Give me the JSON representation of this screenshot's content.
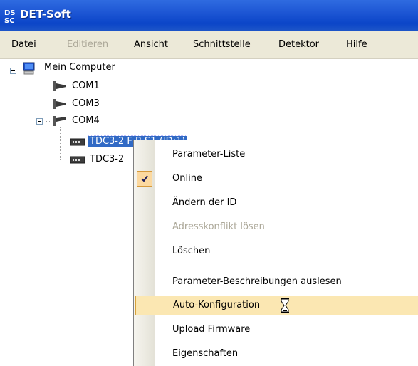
{
  "window": {
    "title": "DET-Soft",
    "logo_text": "DS"
  },
  "menubar": {
    "items": [
      {
        "label": "Datei",
        "disabled": false
      },
      {
        "label": "Editieren",
        "disabled": true
      },
      {
        "label": "Ansicht",
        "disabled": false
      },
      {
        "label": "Schnittstelle",
        "disabled": false
      },
      {
        "label": "Detektor",
        "disabled": false
      },
      {
        "label": "Hilfe",
        "disabled": false
      }
    ]
  },
  "tree": {
    "root": {
      "label": "Mein Computer",
      "icon": "computer-icon",
      "expanded": true
    },
    "ports": [
      {
        "label": "COM1",
        "icon": "serial-port-icon"
      },
      {
        "label": "COM3",
        "icon": "serial-port-icon"
      },
      {
        "label": "COM4",
        "icon": "serial-port-icon",
        "expanded": true
      }
    ],
    "devices": [
      {
        "label": "TDC3-2 F B S1 (ID:1)",
        "icon": "device-icon",
        "selected": true
      },
      {
        "label": "TDC3-2",
        "icon": "device-icon",
        "selected": false
      }
    ]
  },
  "context_menu": {
    "items": [
      {
        "label": "Parameter-Liste",
        "disabled": false,
        "checked": false
      },
      {
        "label": "Online",
        "disabled": false,
        "checked": true
      },
      {
        "label": "Ändern der ID",
        "disabled": false,
        "checked": false
      },
      {
        "label": "Adresskonflikt lösen",
        "disabled": true,
        "checked": false
      },
      {
        "label": "Löschen",
        "disabled": false,
        "checked": false
      },
      {
        "label": "Parameter-Beschreibungen auslesen",
        "disabled": false,
        "checked": false
      },
      {
        "label": "Auto-Konfiguration",
        "disabled": false,
        "checked": false,
        "hovered": true
      },
      {
        "label": "Upload Firmware",
        "disabled": false,
        "checked": false
      },
      {
        "label": "Eigenschaften",
        "disabled": false,
        "checked": false
      }
    ],
    "icons": {
      "check": "checkmark-icon",
      "cursor": "hourglass-cursor-icon"
    }
  },
  "colors": {
    "titlebar": "#0b45c8",
    "menubar_bg": "#ece9d8",
    "selection": "#316ac5",
    "hover_bg": "#fbe7b2",
    "hover_border": "#d6a23c",
    "disabled_text": "#aca899"
  }
}
